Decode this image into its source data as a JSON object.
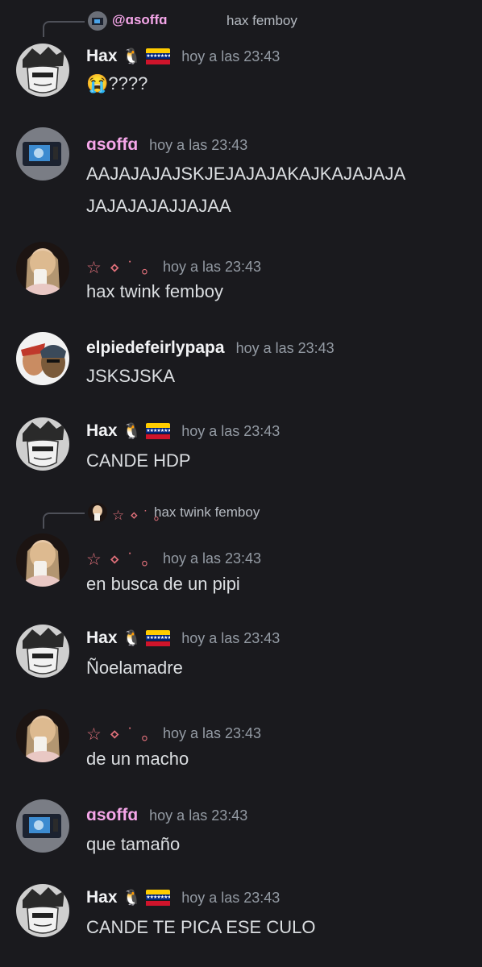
{
  "theme": {
    "background": "#1a1a1e",
    "username_default": "#f2f3f5",
    "username_pink": "#f5a6e9",
    "username_star": "#e0707a",
    "timestamp": "#949ba4",
    "message_text": "#dbdee1"
  },
  "messages": [
    {
      "reply": {
        "author": "@ɑsoffɑ",
        "text": "hax femboy"
      },
      "author": "Hax",
      "badge": "🐧",
      "flag": "venezuela-flag-icon",
      "time": "hoy a las 23:43",
      "content": "😭????"
    },
    {
      "author": "ɑsoffɑ",
      "time": "hoy a las 23:43",
      "content": "AAJAJAJAJSKJEJAJAJAKAJKAJAJAJA\nJAJAJAJAJJAJAA"
    },
    {
      "author": "☆ ⋄ ˙ ｡",
      "time": "hoy a las 23:43",
      "content": "hax twink femboy"
    },
    {
      "author": "elpiedefeirlypapa",
      "time": "hoy a las 23:43",
      "content": "JSKSJSKA"
    },
    {
      "author": "Hax",
      "badge": "🐧",
      "flag": "venezuela-flag-icon",
      "time": "hoy a las 23:43",
      "content": "CANDE HDP"
    },
    {
      "reply": {
        "author": "☆ ⋄ ˙ ｡",
        "text": "hax twink femboy"
      },
      "author": "☆ ⋄ ˙ ｡",
      "time": "hoy a las 23:43",
      "content": "en busca de un pipi"
    },
    {
      "author": "Hax",
      "badge": "🐧",
      "flag": "venezuela-flag-icon",
      "time": "hoy a las 23:43",
      "content": "Ñoelamadre"
    },
    {
      "author": "☆ ⋄ ˙ ｡",
      "time": "hoy a las 23:43",
      "content": "de un macho"
    },
    {
      "author": "ɑsoffɑ",
      "time": "hoy a las 23:43",
      "content": "que tamaño"
    },
    {
      "author": "Hax",
      "badge": "🐧",
      "flag": "venezuela-flag-icon",
      "time": "hoy a las 23:43",
      "content": "CANDE TE PICA ESE CULO"
    }
  ]
}
